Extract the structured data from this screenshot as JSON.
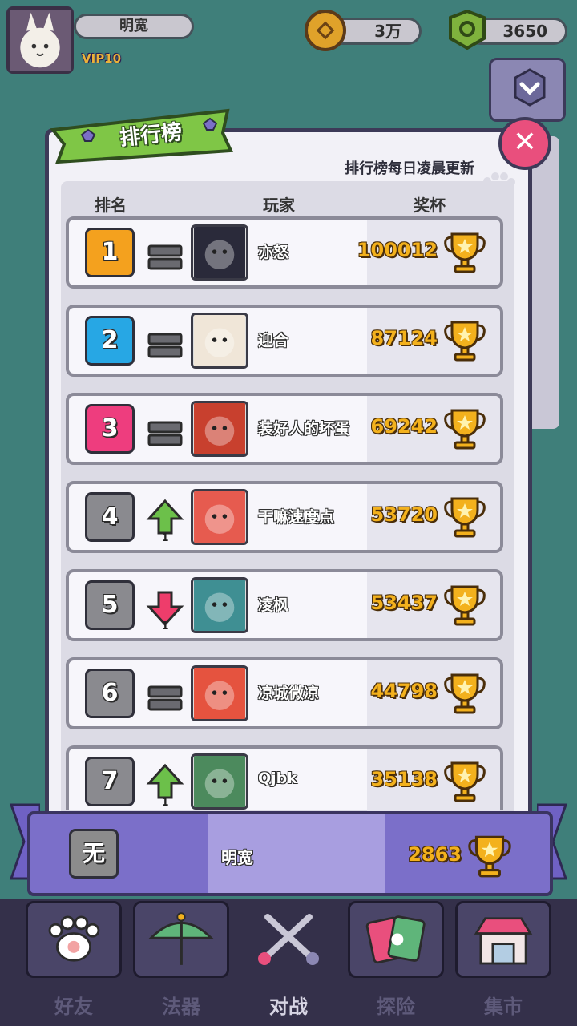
{
  "header": {
    "player_name": "明宽",
    "vip_label": "VIP10",
    "coins": "3万",
    "gems": "3650"
  },
  "leaderboard": {
    "title": "排行榜",
    "update_note": "排行榜每日凌晨更新",
    "columns": {
      "rank": "排名",
      "player": "玩家",
      "trophies": "奖杯"
    },
    "rows": [
      {
        "rank": "1",
        "trend": "same",
        "change": "",
        "name": "亦怒",
        "score": "100012",
        "badge_color": "#f4a11e"
      },
      {
        "rank": "2",
        "trend": "same",
        "change": "",
        "name": "迎合",
        "score": "87124",
        "badge_color": "#27a7e4"
      },
      {
        "rank": "3",
        "trend": "same",
        "change": "",
        "name": "装好人的坏蛋",
        "score": "69242",
        "badge_color": "#ee3d7e"
      },
      {
        "rank": "4",
        "trend": "up",
        "change": "1",
        "name": "干嘛速度点",
        "score": "53720",
        "badge_color": "#8a8a8f"
      },
      {
        "rank": "5",
        "trend": "down",
        "change": "1",
        "name": "凌枫",
        "score": "53437",
        "badge_color": "#8a8a8f"
      },
      {
        "rank": "6",
        "trend": "same",
        "change": "",
        "name": "凉城微凉",
        "score": "44798",
        "badge_color": "#8a8a8f"
      },
      {
        "rank": "7",
        "trend": "up",
        "change": "1",
        "name": "Qjbk",
        "score": "35138",
        "badge_color": "#8a8a8f"
      }
    ],
    "self": {
      "rank": "无",
      "name": "明宽",
      "score": "2863"
    }
  },
  "nav": {
    "items": [
      {
        "label": "好友",
        "icon": "paw-icon"
      },
      {
        "label": "法器",
        "icon": "umbrella-icon"
      },
      {
        "label": "对战",
        "icon": "crossed-swords-icon",
        "active": true
      },
      {
        "label": "探险",
        "icon": "cards-icon"
      },
      {
        "label": "集市",
        "icon": "market-stall-icon"
      }
    ]
  },
  "colors": {
    "accent": "#e94f7d",
    "ribbon": "#7fc646",
    "panel_border": "#3d3a58",
    "trophy": "#f3b11d"
  }
}
